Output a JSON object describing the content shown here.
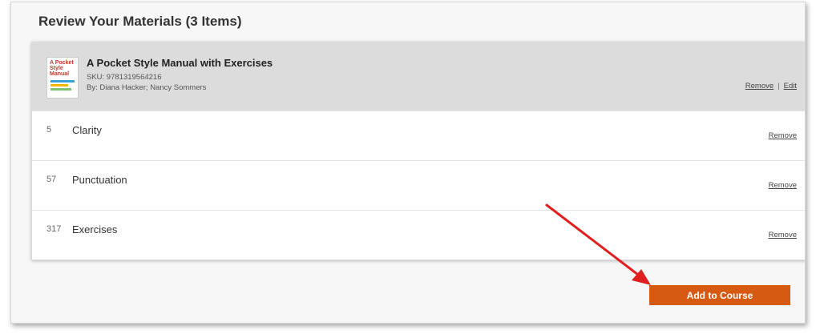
{
  "section": {
    "title": "Review Your Materials (3 Items)"
  },
  "book": {
    "title": "A Pocket Style Manual with Exercises",
    "sku": "SKU: 9781319564216",
    "authors": "By: Diana Hacker; Nancy Sommers",
    "remove_label": "Remove",
    "separator": "|",
    "edit_label": "Edit",
    "cover_text": "A Pocket Style Manual"
  },
  "chapters": [
    {
      "number": "5",
      "title": "Clarity",
      "remove_label": "Remove"
    },
    {
      "number": "57",
      "title": "Punctuation",
      "remove_label": "Remove"
    },
    {
      "number": "317",
      "title": "Exercises",
      "remove_label": "Remove"
    }
  ],
  "add_button": {
    "label": "Add to Course"
  },
  "colors": {
    "accent": "#d65a11",
    "arrow": "#e02020",
    "book_row_bg": "#dcdcdc"
  },
  "icons": {
    "annotation_arrow": "red-arrow-icon",
    "cover": "book-cover-icon"
  }
}
